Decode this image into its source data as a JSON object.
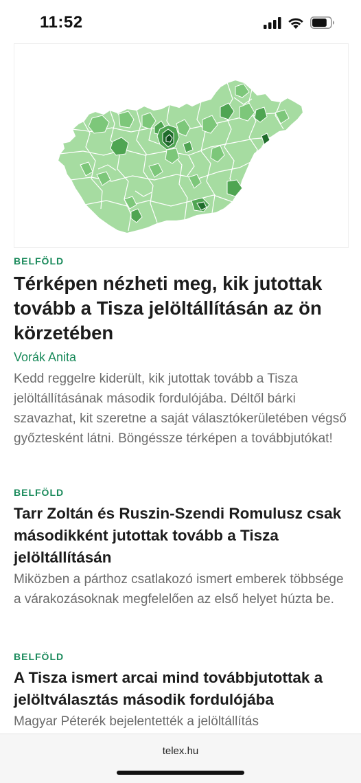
{
  "status_bar": {
    "time": "11:52",
    "battery_level": 0.8
  },
  "map": {
    "colors": {
      "light": "#a6dca1",
      "mid": "#7dc77a",
      "dark": "#4fa552",
      "darkest": "#1f6d2b",
      "border": "#ffffff"
    }
  },
  "articles": [
    {
      "category": "BELFÖLD",
      "title": "Térképen nézheti meg, kik jutottak tovább a Tisza jelöltállításán az ön körzetében",
      "author": "Vorák Anita",
      "lead": "Kedd reggelre kiderült, kik jutottak tovább a Tisza jelöltállításának második fordulójába. Déltől bárki szavazhat, kit szeretne a saját választókerületében végső győztesként látni. Böngéssze térképen a továbbjutókat!"
    },
    {
      "category": "BELFÖLD",
      "title": "Tarr Zoltán és Ruszin-Szendi Romulusz csak másodikként jutottak tovább a Tisza jelöltállításán",
      "lead": "Miközben a párthoz csatlakozó ismert emberek többsége a várakozásoknak megfelelően az első helyet húzta be."
    },
    {
      "category": "BELFÖLD",
      "title": "A Tisza ismert arcai mind továbbjutottak a jelöltválasztás második fordulójába",
      "lead": "Magyar Péterék bejelentették a jelöltállítás"
    }
  ],
  "browser": {
    "url": "telex.hu"
  },
  "colors": {
    "accent": "#1a8a5b"
  }
}
